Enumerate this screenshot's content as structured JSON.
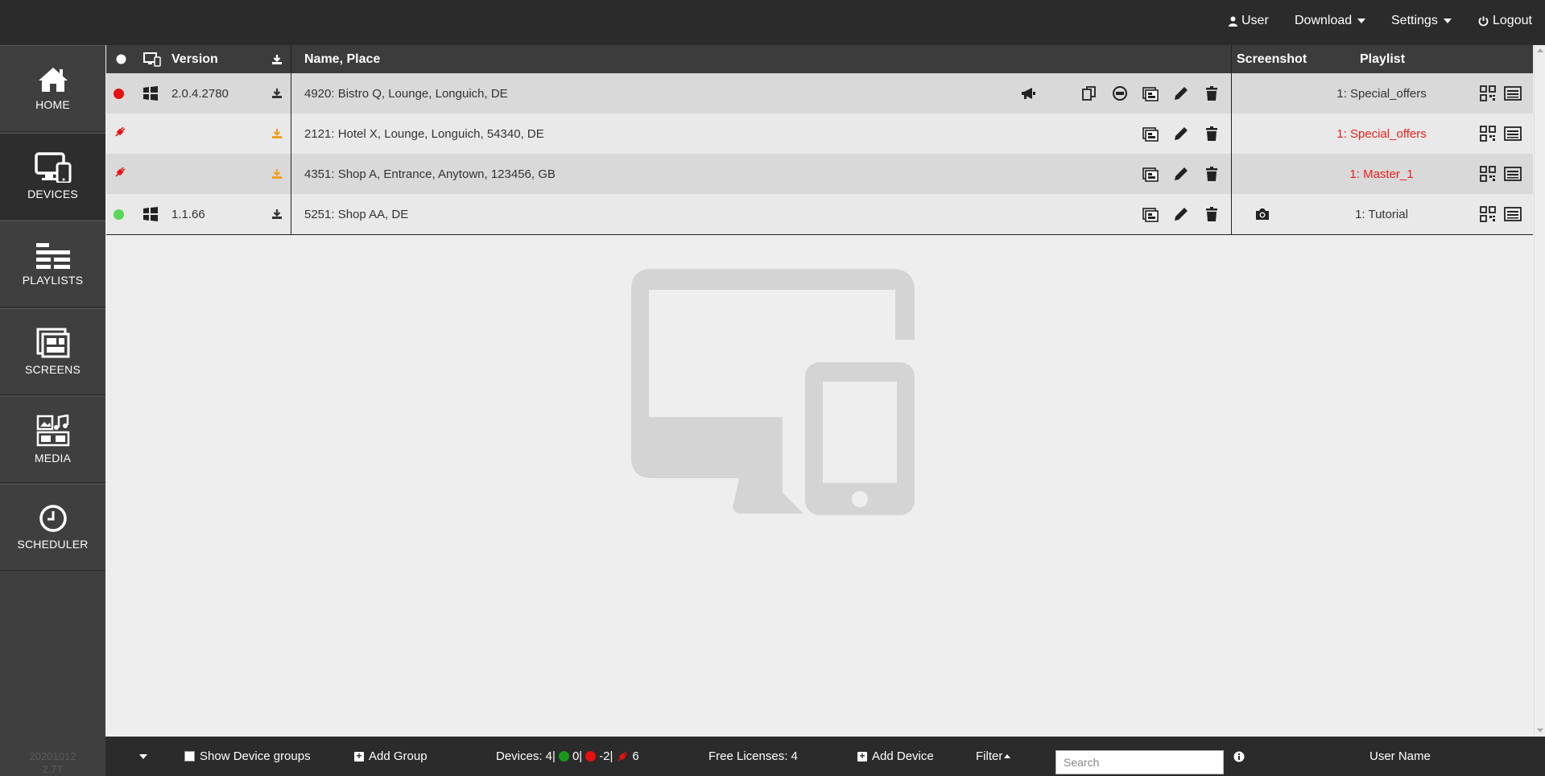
{
  "topbar": {
    "user_label": "User",
    "download_label": "Download",
    "settings_label": "Settings",
    "logout_label": "Logout"
  },
  "sidebar": {
    "items": [
      {
        "label": "HOME",
        "icon": "home-icon",
        "active": false
      },
      {
        "label": "DEVICES",
        "icon": "devices-icon",
        "active": true
      },
      {
        "label": "PLAYLISTS",
        "icon": "playlists-icon",
        "active": false
      },
      {
        "label": "SCREENS",
        "icon": "screens-icon",
        "active": false
      },
      {
        "label": "MEDIA",
        "icon": "media-icon",
        "active": false
      },
      {
        "label": "SCHEDULER",
        "icon": "clock-icon",
        "active": false
      }
    ],
    "version_line1": "20201012",
    "version_line2": "2.7T"
  },
  "table": {
    "headers": {
      "version": "Version",
      "name_place": "Name, Place",
      "screenshot": "Screenshot",
      "playlist": "Playlist"
    },
    "rows": [
      {
        "status": "offline",
        "os": "windows",
        "version": "2.0.4.2780",
        "name": "4920: Bistro Q, Lounge, Longuich, DE",
        "playlist": "1: Special_offers",
        "playlist_alert": false,
        "has_screenshot": false,
        "download_color": "#333333"
      },
      {
        "status": "unplugged",
        "os": "",
        "version": "",
        "name": "2121: Hotel X, Lounge, Longuich, 54340, DE",
        "playlist": "1: Special_offers",
        "playlist_alert": true,
        "has_screenshot": false,
        "download_color": "#f0a020"
      },
      {
        "status": "unplugged",
        "os": "",
        "version": "",
        "name": "4351: Shop A, Entrance, Anytown, 123456, GB",
        "playlist": "1: Master_1",
        "playlist_alert": true,
        "has_screenshot": false,
        "download_color": "#f0a020"
      },
      {
        "status": "online",
        "os": "windows",
        "version": "1.1.66",
        "name": "5251: Shop AA, DE",
        "playlist": "1: Tutorial",
        "playlist_alert": false,
        "has_screenshot": true,
        "download_color": "#333333"
      }
    ]
  },
  "footer": {
    "show_groups_label": "Show Device groups",
    "add_group_label": "Add Group",
    "devices_label": "Devices: 4|",
    "online_count": "0|",
    "offline_count": "-2|",
    "unplugged_count": "6",
    "free_licenses": "Free Licenses: 4",
    "add_device_label": "Add Device",
    "filter_label": "Filter",
    "user_name": "User Name"
  },
  "search": {
    "placeholder": "Search"
  },
  "colors": {
    "online": "#5ad65a",
    "offline": "#e81010",
    "unplugged": "#e81010",
    "alert_text": "#e8201c",
    "warn_download": "#f0a020",
    "footer_green": "#1a9a1a"
  }
}
